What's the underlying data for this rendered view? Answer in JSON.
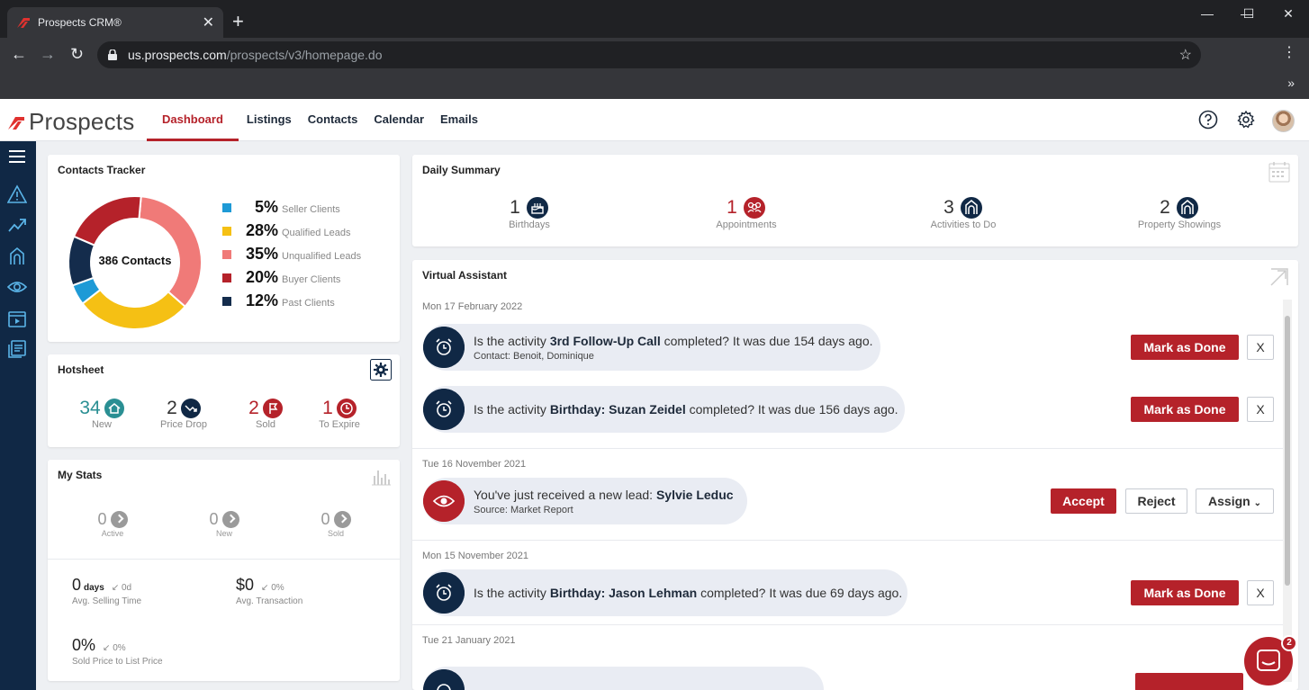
{
  "browser": {
    "tab_title": "Prospects CRM®",
    "tab_close": "✕",
    "new_tab": "+",
    "url_domain": "us.prospects.com",
    "url_path": "/prospects/v3/homepage.do",
    "minimize": "—",
    "maximize": "☐",
    "close": "✕",
    "back": "←",
    "forward": "→",
    "reload": "↻",
    "bookmark": "☆",
    "menu": "⋮",
    "overflow": "»"
  },
  "header": {
    "logo_text": "Prospects",
    "nav": [
      "Dashboard",
      "Listings",
      "Contacts",
      "Calendar",
      "Emails"
    ],
    "active_nav": "Dashboard",
    "icons": [
      "help-icon",
      "gear-icon",
      "avatar"
    ]
  },
  "colors": {
    "brand_red": "#b5222a",
    "navy": "#102845",
    "teal": "#2a8f93",
    "seller": "#1e9ad6",
    "qualified": "#f5c014",
    "unqualified": "#f07a78",
    "buyer": "#b5222a",
    "past": "#142c4c"
  },
  "contacts_tracker": {
    "title": "Contacts Tracker",
    "center_label": "386 Contacts",
    "legend": [
      {
        "pct": "5%",
        "label": "Seller Clients"
      },
      {
        "pct": "28%",
        "label": "Qualified Leads"
      },
      {
        "pct": "35%",
        "label": "Unqualified Leads"
      },
      {
        "pct": "20%",
        "label": "Buyer Clients"
      },
      {
        "pct": "12%",
        "label": "Past Clients"
      }
    ]
  },
  "chart_data": {
    "type": "pie",
    "categories": [
      "Seller Clients",
      "Qualified Leads",
      "Unqualified Leads",
      "Buyer Clients",
      "Past Clients"
    ],
    "values": [
      5,
      28,
      35,
      20,
      12
    ],
    "title": "Contacts Tracker"
  },
  "hotsheet": {
    "title": "Hotsheet",
    "items": [
      {
        "num": "34",
        "label": "New"
      },
      {
        "num": "2",
        "label": "Price Drop"
      },
      {
        "num": "2",
        "label": "Sold"
      },
      {
        "num": "1",
        "label": "To Expire"
      }
    ]
  },
  "my_stats": {
    "title": "My Stats",
    "counts": [
      {
        "num": "0",
        "label": "Active"
      },
      {
        "num": "0",
        "label": "New"
      },
      {
        "num": "0",
        "label": "Sold"
      }
    ],
    "selling_time": {
      "value": "0",
      "unit": "days",
      "delta": "0d",
      "label": "Avg. Selling Time"
    },
    "transaction": {
      "value": "$0",
      "delta": "0%",
      "label": "Avg. Transaction"
    },
    "sold_price": {
      "value": "0%",
      "delta": "0%",
      "label": "Sold Price to List Price"
    }
  },
  "daily_summary": {
    "title": "Daily Summary",
    "items": [
      {
        "num": "1",
        "label": "Birthdays"
      },
      {
        "num": "1",
        "label": "Appointments"
      },
      {
        "num": "3",
        "label": "Activities to Do"
      },
      {
        "num": "2",
        "label": "Property Showings"
      }
    ]
  },
  "virtual_assistant": {
    "title": "Virtual Assistant",
    "dates": [
      "Mon 17 February 2022",
      "Tue 16 November 2021",
      "Mon 15 November 2021",
      "Tue 21 January 2021"
    ],
    "prefix": "Is the activity",
    "tasks": [
      {
        "name": "3rd Follow-Up Call",
        "suffix": "completed? It was due 154 days ago.",
        "sub_label": "Contact:",
        "sub_value": "Benoit, Dominique"
      },
      {
        "name": "Birthday: Suzan Zeidel",
        "suffix": "completed? It was due 156 days ago."
      },
      {
        "name": "Birthday: Jason Lehman",
        "suffix": "completed? It was due 69 days ago."
      }
    ],
    "lead": {
      "prefix": "You've just received a new lead:",
      "name": "Sylvie Leduc",
      "sub_label": "Source:",
      "sub_value": "Market Report"
    },
    "mark_done": "Mark as Done",
    "dismiss": "X",
    "accept": "Accept",
    "reject": "Reject",
    "assign": "Assign"
  },
  "chat": {
    "badge": "2"
  }
}
